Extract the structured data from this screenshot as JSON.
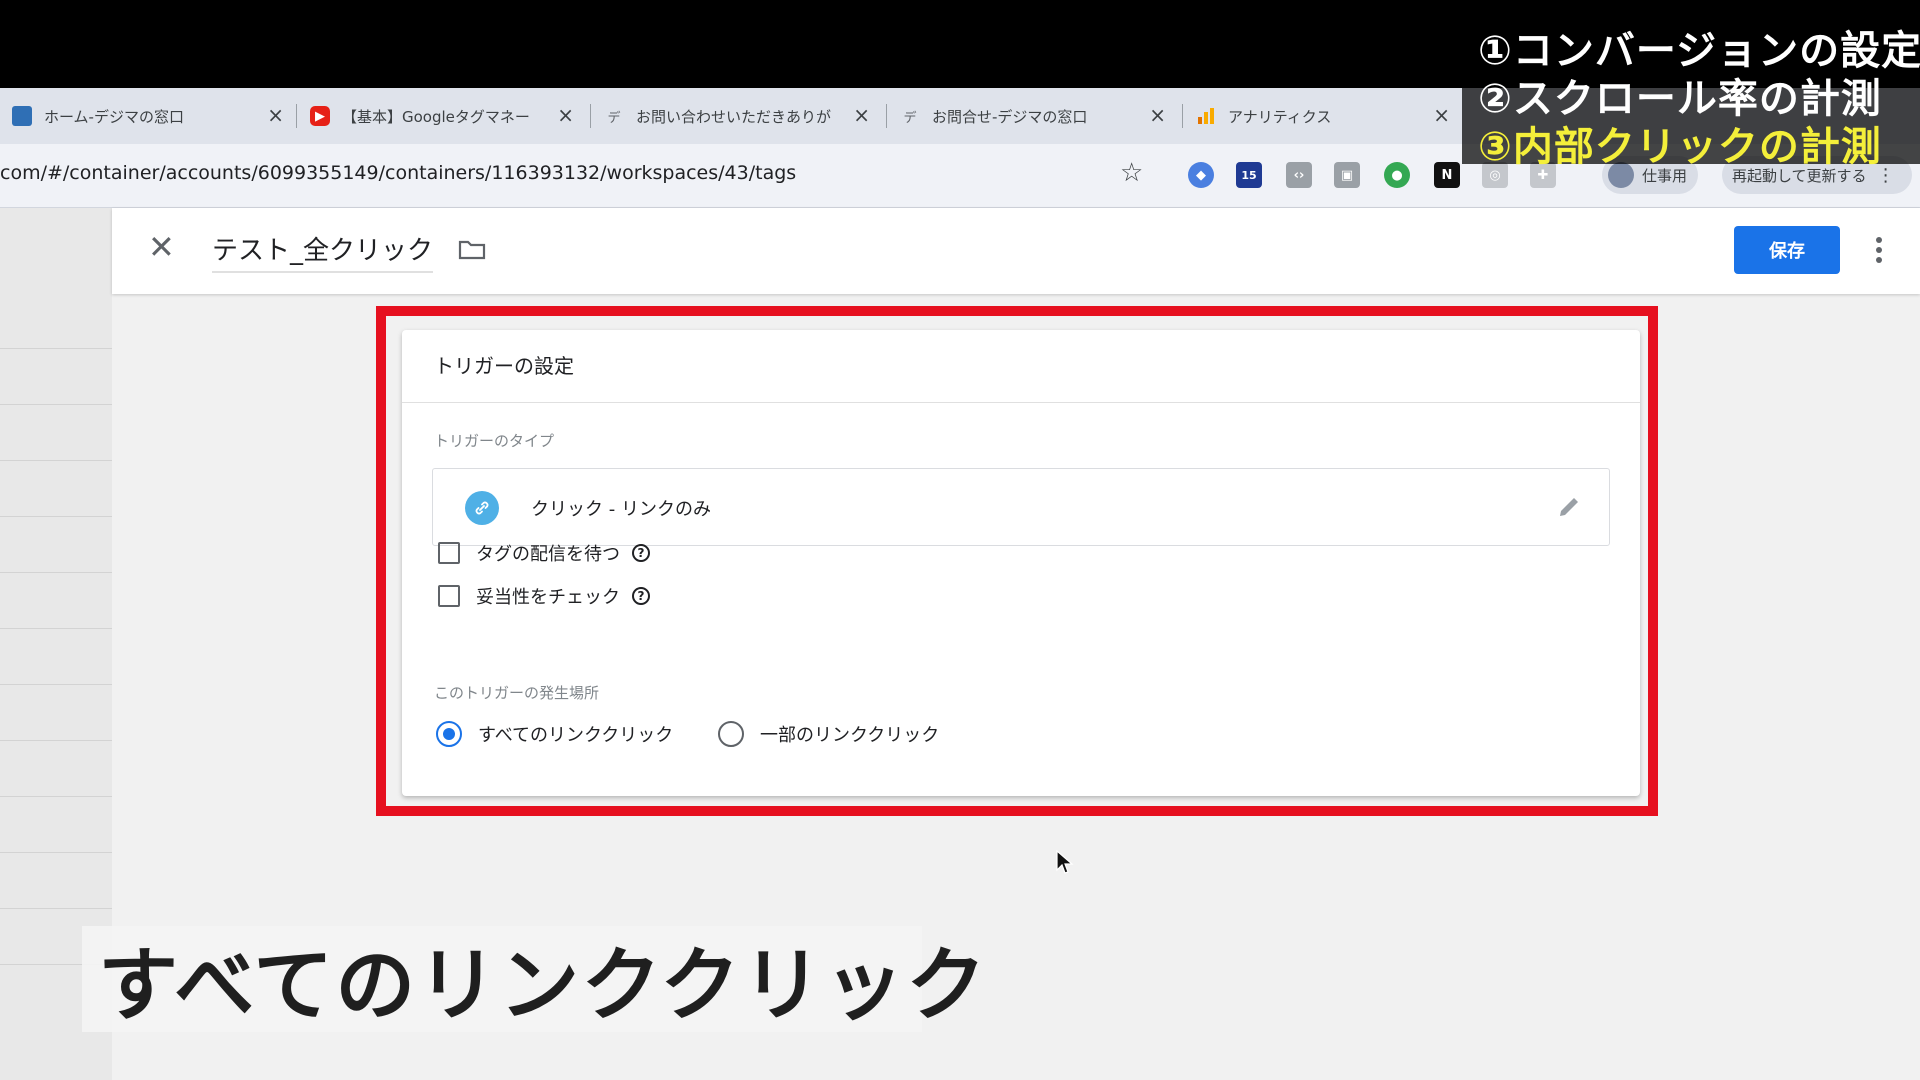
{
  "overlay": {
    "line1": "①コンバージョンの設定",
    "line2": "②スクロール率の計測",
    "line3": "③内部クリックの計測"
  },
  "browser": {
    "tabs": [
      {
        "title": "ホーム-デジマの窓口",
        "favicon": "site-icon",
        "color": "#2f6fb5"
      },
      {
        "title": "【基本】Googleタグマネー",
        "favicon": "youtube-icon",
        "color": "#e62117"
      },
      {
        "title": "お問い合わせいただきありが",
        "favicon": "デ",
        "color": "#6b6b6b"
      },
      {
        "title": "お問合せ-デジマの窓口",
        "favicon": "デ",
        "color": "#6b6b6b"
      },
      {
        "title": "アナリティクス",
        "favicon": "analytics-icon",
        "color": "#f9ab00"
      }
    ],
    "url": "com/#/container/accounts/6099355149/containers/116393132/workspaces/43/tags",
    "extension_badge": "15",
    "profile_label": "仕事用",
    "update_label": "再起動して更新する"
  },
  "editor": {
    "tag_name": "テスト_全クリック",
    "save_label": "保存"
  },
  "trigger_card": {
    "title": "トリガーの設定",
    "type_label": "トリガーのタイプ",
    "type_value": "クリック - リンクのみ",
    "checkbox_wait": "タグの配信を待つ",
    "checkbox_validate": "妥当性をチェック",
    "fires_on_label": "このトリガーの発生場所",
    "radio_all": "すべてのリンククリック",
    "radio_some": "一部のリンククリック",
    "selected": "すべてのリンククリック"
  },
  "subtitle": "すべてのリンククリック",
  "colors": {
    "highlight_frame": "#e6101f",
    "save_button": "#1a73e8",
    "overlay_highlight": "#f4ef3a"
  }
}
